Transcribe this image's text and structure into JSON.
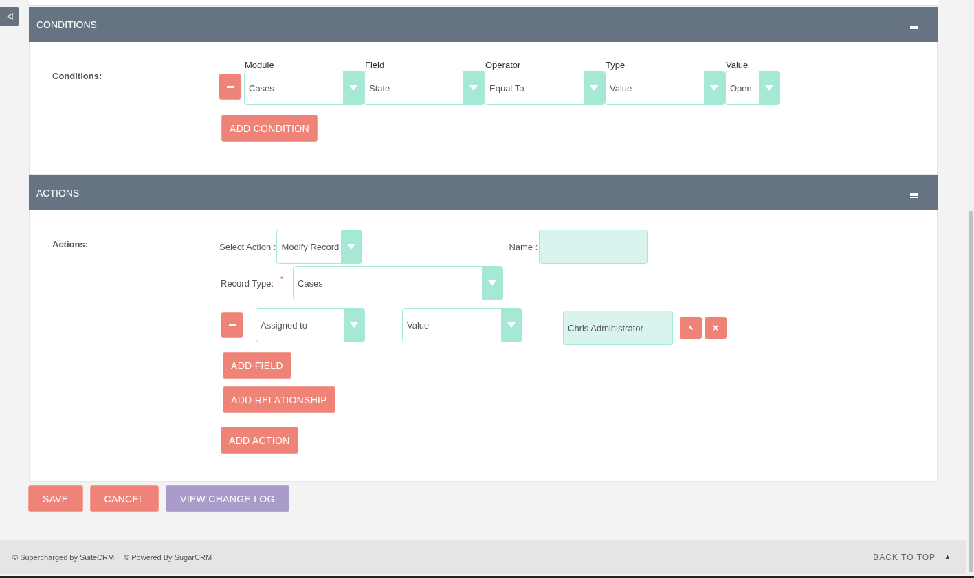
{
  "conditions_panel": {
    "title": "CONDITIONS",
    "label": "Conditions:",
    "columns": [
      "Module",
      "Field",
      "Operator",
      "Type",
      "Value"
    ],
    "rows": [
      {
        "values": [
          "Cases",
          "State",
          "Equal To",
          "Value",
          "Open"
        ]
      }
    ],
    "add_button": "ADD CONDITION"
  },
  "actions_panel": {
    "title": "ACTIONS",
    "label": "Actions:",
    "select_action_label": "Select Action :",
    "select_action": "Modify Record",
    "name_label": "Name :",
    "record_type_label": "Record Type:",
    "required_mark": "*",
    "record_type": "Cases",
    "field_rows": [
      {
        "field": "Assigned to",
        "type": "Value",
        "value": "Chris Administrator"
      }
    ],
    "buttons": [
      "ADD FIELD",
      "ADD RELATIONSHIP",
      "ADD ACTION"
    ]
  },
  "buttons": [
    {
      "label": "SAVE",
      "kind": "primary"
    },
    {
      "label": "CANCEL",
      "kind": "primary"
    },
    {
      "label": "VIEW CHANGE LOG",
      "kind": "secondary"
    }
  ],
  "footer": {
    "credits": [
      "© Supercharged by SuiteCRM",
      "© Powered By SugarCRM"
    ],
    "back_to_top": "BACK TO TOP",
    "back_to_top_glyph": "▲"
  }
}
